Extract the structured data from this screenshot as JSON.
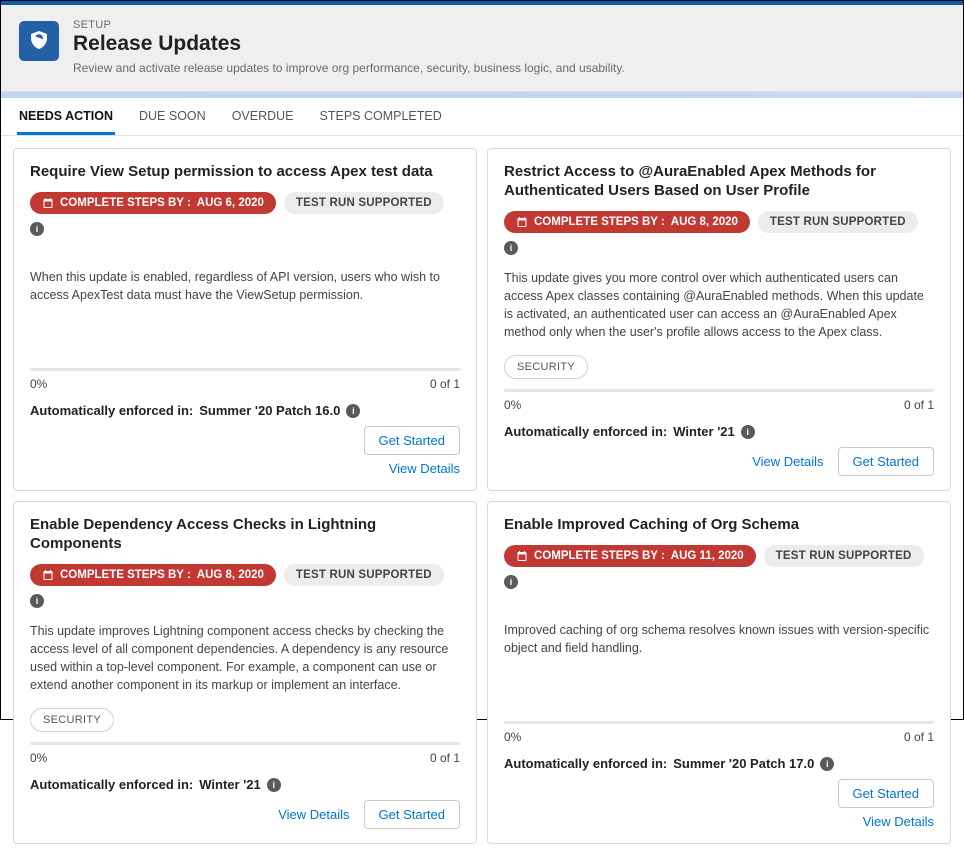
{
  "header": {
    "eyebrow": "SETUP",
    "title": "Release Updates",
    "description": "Review and activate release updates to improve org performance, security, business logic, and usability."
  },
  "tabs": [
    {
      "label": "NEEDS ACTION",
      "active": true
    },
    {
      "label": "DUE SOON",
      "active": false
    },
    {
      "label": "OVERDUE",
      "active": false
    },
    {
      "label": "STEPS COMPLETED",
      "active": false
    }
  ],
  "labels": {
    "complete_prefix": "COMPLETE STEPS BY :",
    "test_run": "TEST RUN SUPPORTED",
    "enforced_prefix": "Automatically enforced in:",
    "get_started": "Get Started",
    "view_details": "View Details",
    "progress_count": "0 of 1",
    "progress_pct": "0%"
  },
  "cards": [
    {
      "title": "Require View Setup permission to access Apex test data",
      "deadline": "AUG 6, 2020",
      "description": "When this update is enabled, regardless of API version, users who wish to access ApexTest data must have the ViewSetup permission.",
      "tags": [],
      "enforced": "Summer '20 Patch 16.0",
      "actions_layout": "col_btn_first"
    },
    {
      "title": "Restrict Access to @AuraEnabled Apex Methods for Authenticated Users Based on User Profile",
      "deadline": "AUG 8, 2020",
      "description": "This update gives you more control over which authenticated users can access Apex classes containing @AuraEnabled methods. When this update is activated, an authenticated user can access an @AuraEnabled Apex method only when the user's profile allows access to the Apex class.",
      "tags": [
        "SECURITY"
      ],
      "enforced": "Winter '21",
      "actions_layout": "row_link_first"
    },
    {
      "title": "Enable Dependency Access Checks in Lightning Components",
      "deadline": "AUG 8, 2020",
      "description": "This update improves Lightning component access checks by checking the access level of all component dependencies. A dependency is any resource used within a top-level component. For example, a component can use or extend another component in its markup or implement an interface.",
      "tags": [
        "SECURITY"
      ],
      "enforced": "Winter '21",
      "actions_layout": "row_link_first"
    },
    {
      "title": "Enable Improved Caching of Org Schema",
      "deadline": "AUG 11, 2020",
      "description": "Improved caching of org schema resolves known issues with version-specific object and field handling.",
      "tags": [],
      "enforced": "Summer '20 Patch 17.0",
      "actions_layout": "col_btn_first"
    }
  ]
}
